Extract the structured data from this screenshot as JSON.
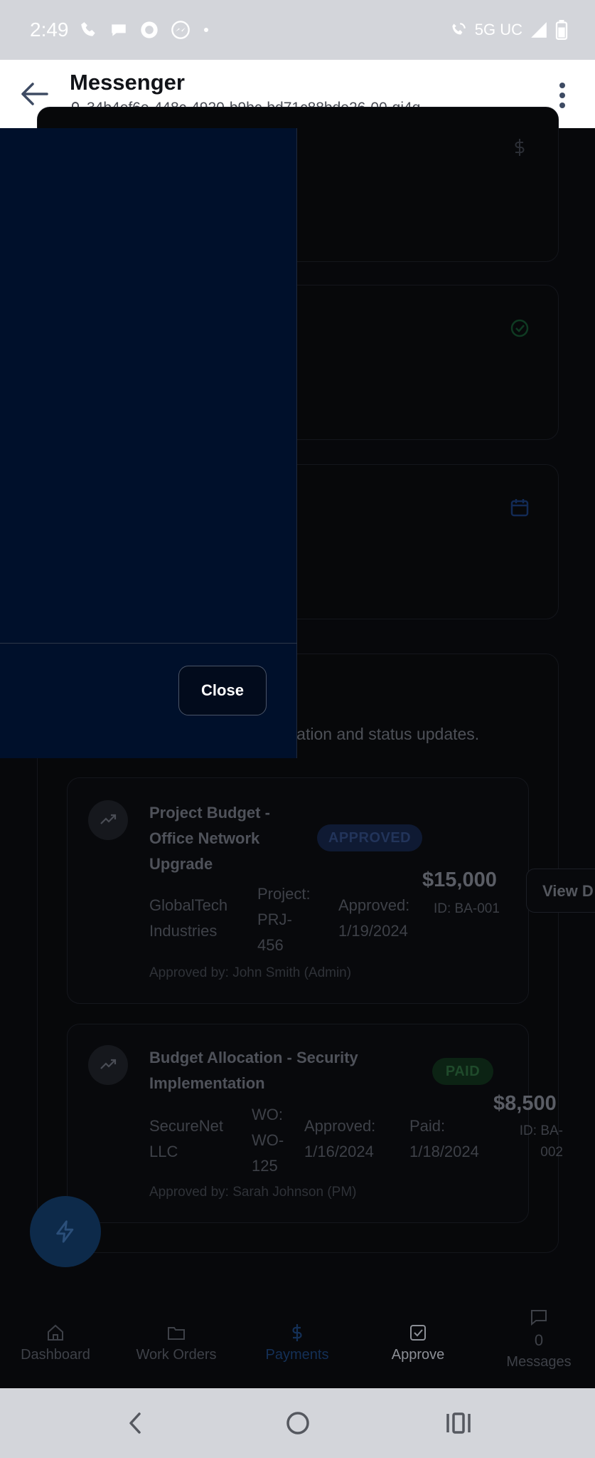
{
  "status_bar": {
    "time": "2:49",
    "network": "5G UC",
    "left_icons": [
      "phone-icon",
      "chat-bubble-icon",
      "app-icon",
      "messenger-icon",
      "dot-icon"
    ],
    "right_icons": [
      "wifi-call-icon",
      "signal-icon",
      "battery-icon"
    ]
  },
  "header": {
    "title": "Messenger",
    "url": "34b4ef6e-448c-4920-b9bc-bd71c88bde26-00-gj4q..."
  },
  "section": {
    "description": "mation and status updates."
  },
  "items": [
    {
      "title_lines": [
        "Project Budget -",
        "Office Network",
        "Upgrade"
      ],
      "status": "APPROVED",
      "amount": "$15,000",
      "id": "ID: BA-001",
      "client_lines": [
        "GlobalTech",
        "Industries"
      ],
      "ref_lines": [
        "Project:",
        "PRJ-",
        "456"
      ],
      "date1_lines": [
        "Approved:",
        "1/19/2024"
      ],
      "approver": "Approved by: John Smith (Admin)"
    },
    {
      "title_lines": [
        "Budget Allocation - Security",
        "Implementation"
      ],
      "status": "PAID",
      "amount": "$8,500",
      "id_lines": [
        "ID: BA-",
        "002"
      ],
      "client_lines": [
        "SecureNet",
        "LLC"
      ],
      "ref_lines": [
        "WO:",
        "WO-",
        "125"
      ],
      "date1_lines": [
        "Approved:",
        "1/16/2024"
      ],
      "date2_lines": [
        "Paid:",
        "1/18/2024"
      ],
      "approver": "Approved by: Sarah Johnson (PM)"
    }
  ],
  "view_button": "View D",
  "modal": {
    "close_label": "Close"
  },
  "bottom_nav": [
    {
      "label": "Dashboard"
    },
    {
      "label": "Work Orders"
    },
    {
      "label": "Payments"
    },
    {
      "label": "Approve"
    },
    {
      "label": "Messages",
      "count": "0"
    }
  ],
  "colors": {
    "badge_approved_bg": "#0f1a33",
    "badge_approved_text": "#22345a",
    "badge_paid_bg": "#0c2314",
    "badge_paid_text": "#1f4a2b",
    "modal_bg": "#00102b",
    "nav_active": "#143057"
  }
}
